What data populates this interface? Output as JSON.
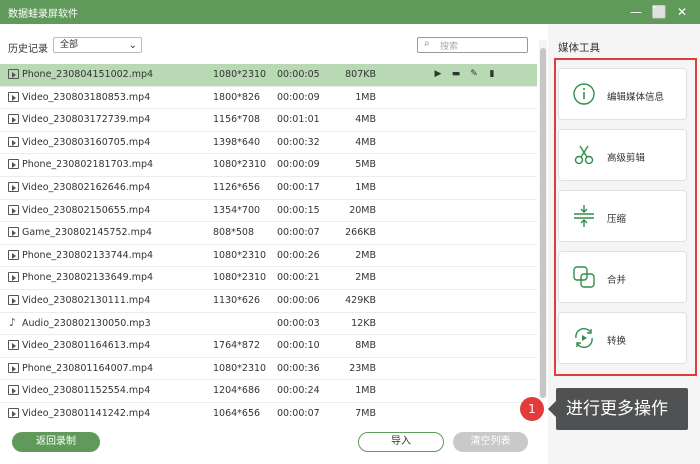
{
  "app": {
    "title": "数据蛙录屏软件"
  },
  "window_controls": {
    "restore": "⬜",
    "minimize": "—",
    "close": "✕"
  },
  "filter": {
    "label": "历史记录",
    "selected": "全部"
  },
  "search": {
    "placeholder": "搜索"
  },
  "files": [
    {
      "name": "Phone_230804151002.mp4",
      "resolution": "1080*2310",
      "duration": "00:00:05",
      "size": "807KB",
      "type": "video",
      "selected": true
    },
    {
      "name": "Video_230803180853.mp4",
      "resolution": "1800*826",
      "duration": "00:00:09",
      "size": "1MB",
      "type": "video"
    },
    {
      "name": "Video_230803172739.mp4",
      "resolution": "1156*708",
      "duration": "00:01:01",
      "size": "4MB",
      "type": "video"
    },
    {
      "name": "Video_230803160705.mp4",
      "resolution": "1398*640",
      "duration": "00:00:32",
      "size": "4MB",
      "type": "video"
    },
    {
      "name": "Phone_230802181703.mp4",
      "resolution": "1080*2310",
      "duration": "00:00:09",
      "size": "5MB",
      "type": "video"
    },
    {
      "name": "Video_230802162646.mp4",
      "resolution": "1126*656",
      "duration": "00:00:17",
      "size": "1MB",
      "type": "video"
    },
    {
      "name": "Video_230802150655.mp4",
      "resolution": "1354*700",
      "duration": "00:00:15",
      "size": "20MB",
      "type": "video"
    },
    {
      "name": "Game_230802145752.mp4",
      "resolution": "808*508",
      "duration": "00:00:07",
      "size": "266KB",
      "type": "video"
    },
    {
      "name": "Phone_230802133744.mp4",
      "resolution": "1080*2310",
      "duration": "00:00:26",
      "size": "2MB",
      "type": "video"
    },
    {
      "name": "Phone_230802133649.mp4",
      "resolution": "1080*2310",
      "duration": "00:00:21",
      "size": "2MB",
      "type": "video"
    },
    {
      "name": "Video_230802130111.mp4",
      "resolution": "1130*626",
      "duration": "00:00:06",
      "size": "429KB",
      "type": "video"
    },
    {
      "name": "Audio_230802130050.mp3",
      "resolution": "",
      "duration": "00:00:03",
      "size": "12KB",
      "type": "audio"
    },
    {
      "name": "Video_230801164613.mp4",
      "resolution": "1764*872",
      "duration": "00:00:10",
      "size": "8MB",
      "type": "video"
    },
    {
      "name": "Phone_230801164007.mp4",
      "resolution": "1080*2310",
      "duration": "00:00:36",
      "size": "23MB",
      "type": "video"
    },
    {
      "name": "Video_230801152554.mp4",
      "resolution": "1204*686",
      "duration": "00:00:24",
      "size": "1MB",
      "type": "video"
    },
    {
      "name": "Video_230801141242.mp4",
      "resolution": "1064*656",
      "duration": "00:00:07",
      "size": "7MB",
      "type": "video"
    }
  ],
  "row_actions": [
    "play-icon",
    "folder-icon",
    "tools-icon",
    "trash-icon"
  ],
  "buttons": {
    "back": "返回录制",
    "import": "导入",
    "clear": "清空列表"
  },
  "media_tools": {
    "title": "媒体工具",
    "items": [
      {
        "label": "编辑媒体信息",
        "icon": "info-icon"
      },
      {
        "label": "高级剪辑",
        "icon": "scissors-icon"
      },
      {
        "label": "压缩",
        "icon": "compress-icon"
      },
      {
        "label": "合并",
        "icon": "merge-icon"
      },
      {
        "label": "转换",
        "icon": "convert-icon"
      }
    ]
  },
  "callout": {
    "badge": "1",
    "text": "进行更多操作"
  },
  "colors": {
    "brand_green": "#5f9a5a",
    "selected_row": "#b9d9b5",
    "highlight_red": "#e23b3b",
    "callout_bg": "#4f5152"
  }
}
